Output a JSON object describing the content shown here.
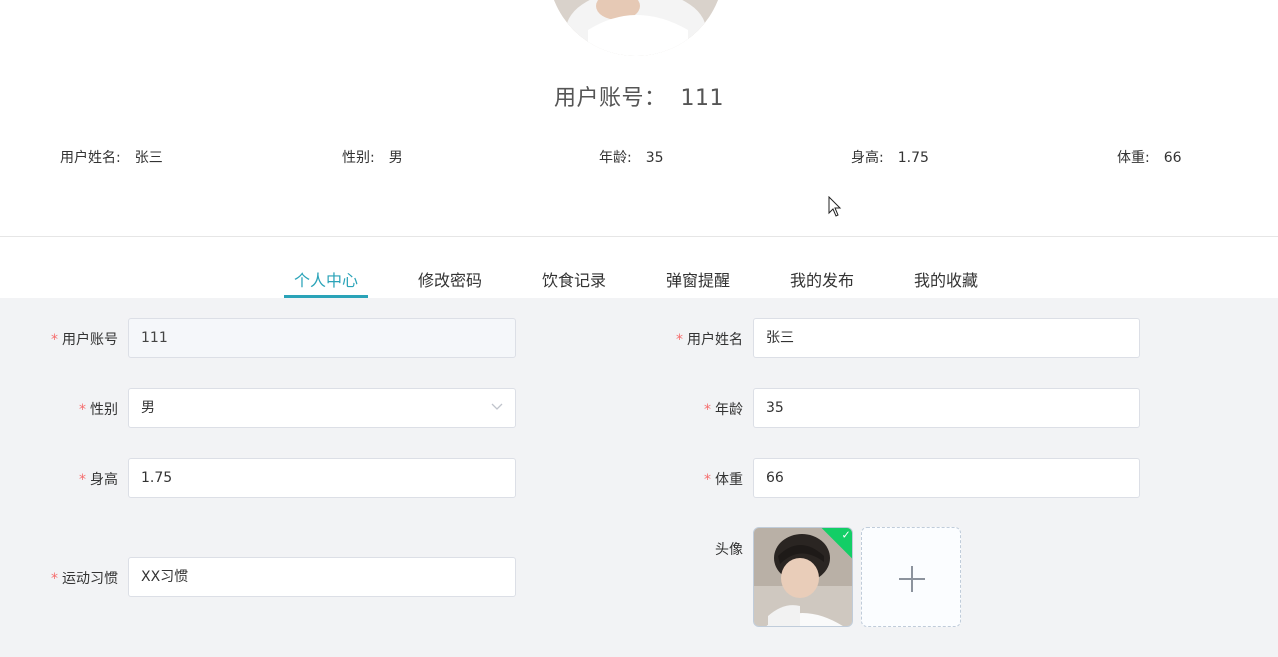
{
  "profile": {
    "account_label": "用户账号：",
    "account_value": "111",
    "info": [
      {
        "label": "用户姓名:",
        "value": "张三"
      },
      {
        "label": "性别:",
        "value": "男"
      },
      {
        "label": "年龄:",
        "value": "35"
      },
      {
        "label": "身高:",
        "value": "1.75"
      },
      {
        "label": "体重:",
        "value": "66"
      }
    ]
  },
  "tabs": [
    {
      "label": "个人中心",
      "active": true
    },
    {
      "label": "修改密码",
      "active": false
    },
    {
      "label": "饮食记录",
      "active": false
    },
    {
      "label": "弹窗提醒",
      "active": false
    },
    {
      "label": "我的发布",
      "active": false
    },
    {
      "label": "我的收藏",
      "active": false
    }
  ],
  "form": {
    "required_mark": "*",
    "account": {
      "label": "用户账号",
      "value": "111"
    },
    "name": {
      "label": "用户姓名",
      "value": "张三"
    },
    "gender": {
      "label": "性别",
      "value": "男"
    },
    "age": {
      "label": "年龄",
      "value": "35"
    },
    "height": {
      "label": "身高",
      "value": "1.75"
    },
    "weight": {
      "label": "体重",
      "value": "66"
    },
    "avatar": {
      "label": "头像",
      "check_glyph": "✓"
    },
    "exercise": {
      "label": "运动习惯",
      "value": "XX习惯"
    }
  },
  "colors": {
    "accent": "#2aa3b8",
    "required": "#f56c6c",
    "upload_success": "#13ce66",
    "form_background": "#f2f3f5"
  },
  "icons": {
    "select_arrow": "chevron-down-icon",
    "upload_add": "plus-icon",
    "upload_success": "check-icon"
  }
}
